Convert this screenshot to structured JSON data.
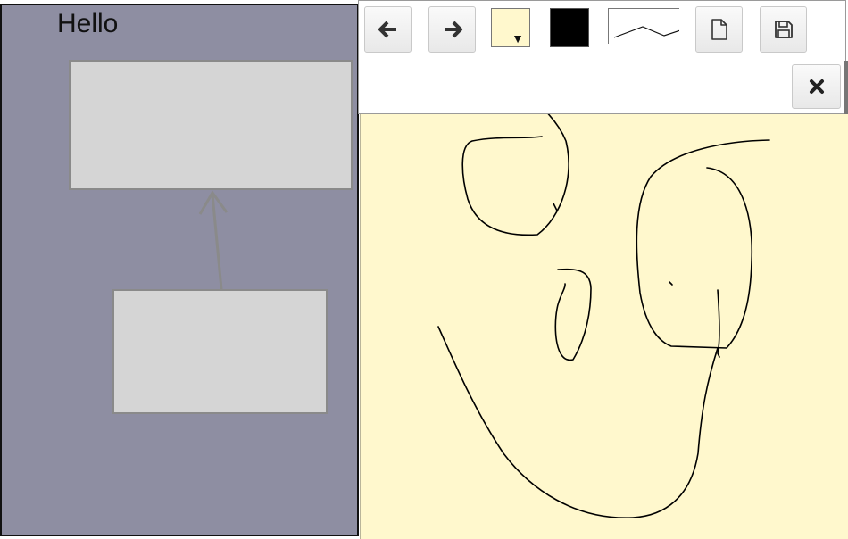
{
  "diagram": {
    "label": "Hello",
    "colors": {
      "background": "#8e8ea2",
      "box": "#d5d5d5",
      "connector": "#8a8a8a"
    }
  },
  "toolbar": {
    "buttons": [
      {
        "name": "back-button",
        "icon": "arrow-left-icon"
      },
      {
        "name": "forward-button",
        "icon": "arrow-right-icon"
      },
      {
        "name": "new-page-button",
        "icon": "file-icon"
      },
      {
        "name": "save-button",
        "icon": "floppy-disk-icon"
      },
      {
        "name": "close-button",
        "icon": "close-icon"
      }
    ],
    "background_color": "#fff8cd",
    "stroke_color": "#000000",
    "stroke_style_icon": "line-style-icon"
  },
  "canvas": {
    "background": "#fff8cd",
    "ink_color": "#000000"
  }
}
